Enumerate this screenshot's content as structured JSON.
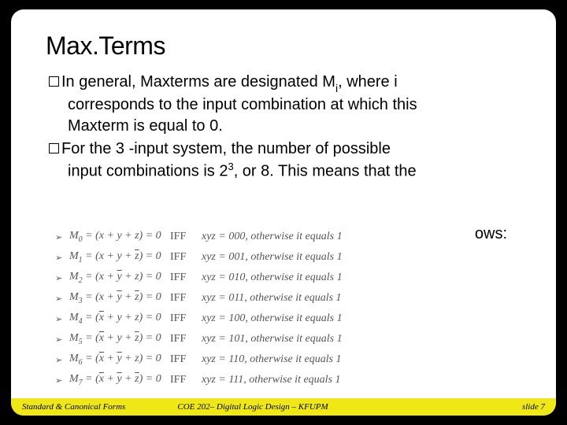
{
  "title": "Max.Terms",
  "para1_lead": "In general, Maxterms are designated M",
  "para1_sub": "i",
  "para1_tail1": ", where i",
  "para1_line2": "corresponds to the input combination at which this",
  "para1_line3": "Maxterm is equal to 0.",
  "para2_lead": "For the 3 -input system, the number of possible",
  "para2_line2a": "input combinations is 2",
  "para2_sup": "3",
  "para2_line2b": ", or 8. This means that the",
  "dangling": "ows:",
  "maxterms": [
    {
      "m": "M",
      "idx": "0",
      "expr": "(x + y + z) = 0",
      "xyz": "xyz = 000",
      "tail": ", otherwise it equals 1"
    },
    {
      "m": "M",
      "idx": "1",
      "expr": "(x + y + z̄) = 0",
      "xyz": "xyz = 001",
      "tail": ", otherwise it equals 1"
    },
    {
      "m": "M",
      "idx": "2",
      "expr": "(x + ȳ + z) = 0",
      "xyz": "xyz = 010",
      "tail": ", otherwise it equals 1"
    },
    {
      "m": "M",
      "idx": "3",
      "expr": "(x + ȳ + z̄) = 0",
      "xyz": "xyz = 011",
      "tail": ", otherwise it equals 1"
    },
    {
      "m": "M",
      "idx": "4",
      "expr": "(x̄ + y + z) = 0",
      "xyz": "xyz = 100",
      "tail": ", otherwise it equals 1"
    },
    {
      "m": "M",
      "idx": "5",
      "expr": "(x̄ + y + z̄) = 0",
      "xyz": "xyz = 101",
      "tail": ", otherwise it equals 1"
    },
    {
      "m": "M",
      "idx": "6",
      "expr": "(x̄ + ȳ + z) = 0",
      "xyz": "xyz = 110",
      "tail": ", otherwise it equals 1"
    },
    {
      "m": "M",
      "idx": "7",
      "expr": "(x̄ + ȳ + z̄) = 0",
      "xyz": "xyz = 111",
      "tail": ", otherwise it equals 1"
    }
  ],
  "iff_label": "IFF",
  "arrow_glyph": "➢",
  "footer": {
    "left": "Standard & Canonical Forms",
    "mid": "COE 202– Digital Logic Design – KFUPM",
    "right": "slide 7"
  }
}
